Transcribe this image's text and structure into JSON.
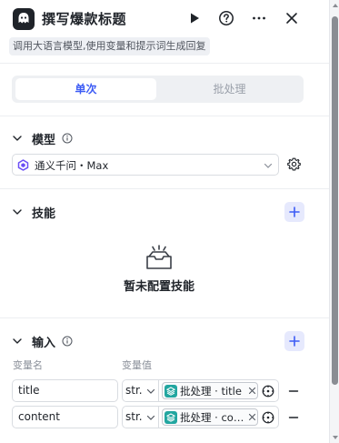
{
  "header": {
    "title": "撰写爆款标题",
    "subtitle": "调用大语言模型,使用变量和提示词生成回复"
  },
  "mode_tabs": [
    {
      "label": "单次",
      "active": true
    },
    {
      "label": "批处理",
      "active": false
    }
  ],
  "model": {
    "section_title": "模型",
    "selected": "通义千问・Max"
  },
  "skills": {
    "section_title": "技能",
    "empty_text": "暂未配置技能"
  },
  "input": {
    "section_title": "输入",
    "col_name": "变量名",
    "col_value": "变量值",
    "rows": [
      {
        "name": "title",
        "type": "str.",
        "ref": "批处理 · title"
      },
      {
        "name": "content",
        "type": "str.",
        "ref": "批处理 · co…"
      }
    ]
  },
  "colors": {
    "accent": "#3d5cf5",
    "ref_icon": "#22a6a0"
  }
}
